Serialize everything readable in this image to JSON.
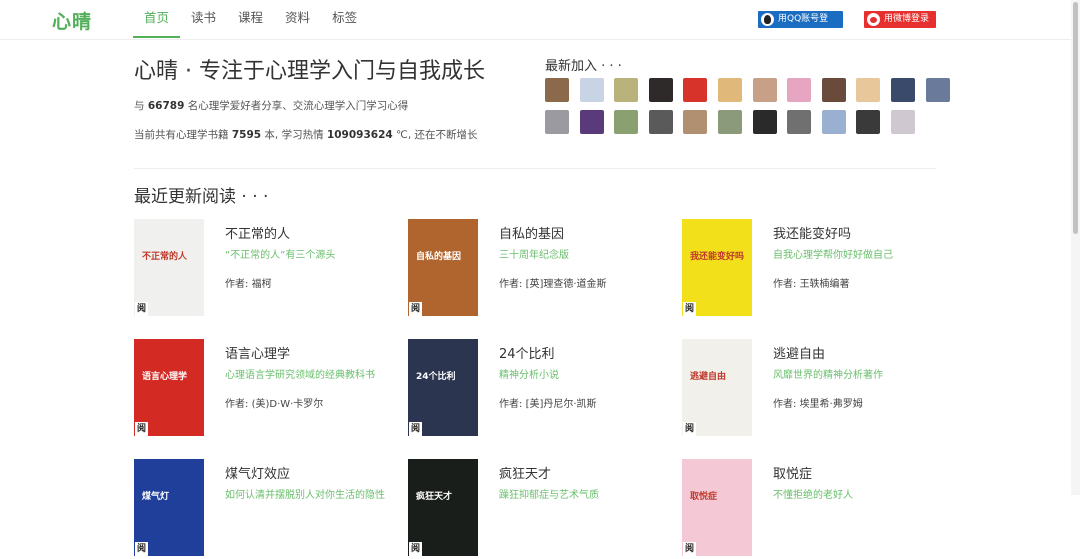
{
  "header": {
    "logo": "心晴",
    "nav": [
      {
        "label": "首页",
        "active": true
      },
      {
        "label": "读书",
        "active": false
      },
      {
        "label": "课程",
        "active": false
      },
      {
        "label": "资料",
        "active": false
      },
      {
        "label": "标签",
        "active": false
      }
    ],
    "qq_login": "用QQ账号登录",
    "weibo_login": "用微博登录"
  },
  "hero": {
    "title": "心晴 · 专注于心理学入门与自我成长",
    "line1_prefix": "与 ",
    "member_count": "66789",
    "line1_suffix": " 名心理学爱好者分享、交流心理学入门学习心得",
    "line2_prefix": "当前共有心理学书籍 ",
    "book_count": "7595",
    "line2_mid": " 本, 学习热情 ",
    "heat": "109093624",
    "line2_suffix": " ℃, 还在不断增长"
  },
  "new_members": {
    "title": "最新加入 · · ·",
    "avatar_colors": [
      "#8a6a4a",
      "#c9d3e6",
      "#b9b27a",
      "#2e2a2a",
      "#d8332b",
      "#e0b97a",
      "#c8a088",
      "#e6a5c0",
      "#6a4a3a",
      "#e8c89a",
      "#3a4a6a",
      "#6a7a9a",
      "#9a9aa0",
      "#5a3a7a",
      "#8aa070",
      "#5a5a5a",
      "#b09070",
      "#8a9a7a",
      "#2a2a2a",
      "#707070",
      "#9ab0d0",
      "#3a3a3a",
      "#d0c8d0"
    ]
  },
  "recent": {
    "title": "最近更新阅读 · · ·",
    "badge": "阅",
    "author_prefix": "作者: ",
    "books": [
      {
        "title": "不正常的人",
        "subtitle": "“不正常的人”有三个源头",
        "author": "福柯",
        "cover_text": "不正常的人",
        "cover_bg": "#f0f0ee"
      },
      {
        "title": "自私的基因",
        "subtitle": "三十周年纪念版",
        "author": "[英]理查德·道金斯",
        "cover_text": "自私的基因",
        "cover_bg": "#b0652e"
      },
      {
        "title": "我还能变好吗",
        "subtitle": "自我心理学帮你好好做自己",
        "author": "王轶楠编著",
        "cover_text": "我还能变好吗",
        "cover_bg": "#f2e01a"
      },
      {
        "title": "语言心理学",
        "subtitle": "心理语言学研究领域的经典教科书",
        "author": "(美)D·W·卡罗尔",
        "cover_text": "语言心理学",
        "cover_bg": "#d42a24"
      },
      {
        "title": "24个比利",
        "subtitle": "精神分析小说",
        "author": "[美]丹尼尔·凯斯",
        "cover_text": "24个比利",
        "cover_bg": "#2c3550"
      },
      {
        "title": "逃避自由",
        "subtitle": "风靡世界的精神分析著作",
        "author": "埃里希·弗罗姆",
        "cover_text": "逃避自由",
        "cover_bg": "#f1f0ea"
      },
      {
        "title": "煤气灯效应",
        "subtitle": "如何认清并摆脱别人对你生活的隐性",
        "author": "",
        "cover_text": "煤气灯",
        "cover_bg": "#1f3f9a"
      },
      {
        "title": "疯狂天才",
        "subtitle": "躁狂抑郁症与艺术气质",
        "author": "",
        "cover_text": "疯狂天才",
        "cover_bg": "#1a1e1a"
      },
      {
        "title": "取悦症",
        "subtitle": "不懂拒绝的老好人",
        "author": "",
        "cover_text": "取悦症",
        "cover_bg": "#f4c8d4"
      }
    ]
  }
}
